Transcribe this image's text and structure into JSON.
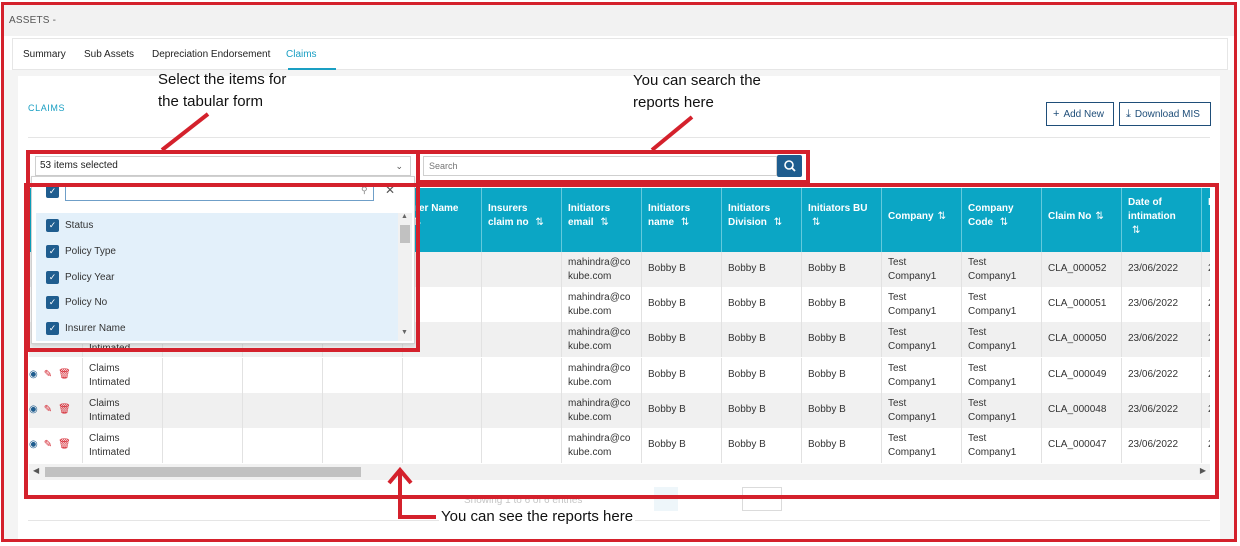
{
  "breadcrumb": "ASSETS -",
  "tabs": [
    {
      "label": "Summary"
    },
    {
      "label": "Sub Assets"
    },
    {
      "label": "Depreciation Endorsement"
    },
    {
      "label": "Claims"
    }
  ],
  "active_tab": "Claims",
  "section_title": "CLAIMS",
  "buttons": {
    "add_new": "Add New",
    "download_mis": "Download MIS"
  },
  "column_select": {
    "value": "53 items selected"
  },
  "search": {
    "placeholder": "Search"
  },
  "dropdown": {
    "search_value": "",
    "items": [
      {
        "label": "Status",
        "checked": true
      },
      {
        "label": "Policy Type",
        "checked": true
      },
      {
        "label": "Policy Year",
        "checked": true
      },
      {
        "label": "Policy No",
        "checked": true
      },
      {
        "label": "Insurer Name",
        "checked": true
      }
    ]
  },
  "table": {
    "headers": {
      "insurer_name": "urer Name",
      "insurers_claim_no": "Insurers claim no",
      "initiators_email": "Initiators email",
      "initiators_name": "Initiators name",
      "initiators_division": "Initiators Division",
      "initiators_bu": "Initiators BU",
      "company": "Company",
      "company_code": "Company Code",
      "claim_no": "Claim No",
      "date_of_intimation": "Date of intimation",
      "next_col": "D"
    },
    "rows": [
      {
        "status": "",
        "email": "mahindra@cokube.com",
        "email_l1": "mahindra@co",
        "email_l2": "kube.com",
        "name": "Bobby B",
        "division": "Bobby B",
        "bu": "Bobby B",
        "company_l1": "Test",
        "company_l2": "Company1",
        "code_l1": "Test",
        "code_l2": "Company1",
        "claim_no": "CLA_000052",
        "date": "23/06/2022",
        "next": "2"
      },
      {
        "status": "",
        "email": "mahindra@cokube.com",
        "email_l1": "mahindra@co",
        "email_l2": "kube.com",
        "name": "Bobby B",
        "division": "Bobby B",
        "bu": "Bobby B",
        "company_l1": "Test",
        "company_l2": "Company1",
        "code_l1": "Test",
        "code_l2": "Company1",
        "claim_no": "CLA_000051",
        "date": "23/06/2022",
        "next": "2"
      },
      {
        "status": "Intimated",
        "email": "mahindra@cokube.com",
        "email_l1": "mahindra@co",
        "email_l2": "kube.com",
        "name": "Bobby B",
        "division": "Bobby B",
        "bu": "Bobby B",
        "company_l1": "Test",
        "company_l2": "Company1",
        "code_l1": "Test",
        "code_l2": "Company1",
        "claim_no": "CLA_000050",
        "date": "23/06/2022",
        "next": "2"
      },
      {
        "status_l1": "Claims",
        "status_l2": "Intimated",
        "email_l1": "mahindra@co",
        "email_l2": "kube.com",
        "name": "Bobby B",
        "division": "Bobby B",
        "bu": "Bobby B",
        "company_l1": "Test",
        "company_l2": "Company1",
        "code_l1": "Test",
        "code_l2": "Company1",
        "claim_no": "CLA_000049",
        "date": "23/06/2022",
        "next": "2"
      },
      {
        "status_l1": "Claims",
        "status_l2": "Intimated",
        "email_l1": "mahindra@co",
        "email_l2": "kube.com",
        "name": "Bobby B",
        "division": "Bobby B",
        "bu": "Bobby B",
        "company_l1": "Test",
        "company_l2": "Company1",
        "code_l1": "Test",
        "code_l2": "Company1",
        "claim_no": "CLA_000048",
        "date": "23/06/2022",
        "next": "2"
      },
      {
        "status_l1": "Claims",
        "status_l2": "Intimated",
        "email_l1": "mahindra@co",
        "email_l2": "kube.com",
        "name": "Bobby B",
        "division": "Bobby B",
        "bu": "Bobby B",
        "company_l1": "Test",
        "company_l2": "Company1",
        "code_l1": "Test",
        "code_l2": "Company1",
        "claim_no": "CLA_000047",
        "date": "23/06/2022",
        "next": "2"
      }
    ]
  },
  "pagination": {
    "info": "Showing 1 to 6 of 6 entries",
    "page": "1"
  },
  "annotations": {
    "select_items_l1": "Select the items for",
    "select_items_l2": "the tabular form",
    "search_l1": "You can search the",
    "search_l2": "reports here",
    "reports": "You can see the reports here"
  },
  "icons": {
    "sort": "up-down-arrows-icon",
    "search": "magnifier-icon",
    "view": "eye-icon",
    "edit": "edit-icon",
    "delete": "trash-icon"
  },
  "colors": {
    "header_bg": "#0ba6c5",
    "primary": "#1f5d8f",
    "annotation": "#d4212c",
    "accent": "#1a9fc3"
  }
}
